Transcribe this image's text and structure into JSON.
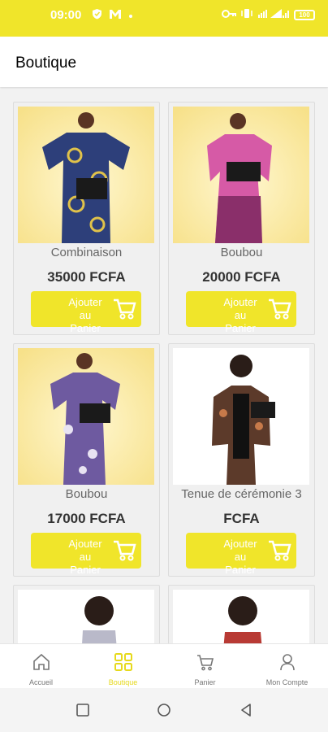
{
  "status_bar": {
    "time": "09:00",
    "battery": "100"
  },
  "app_bar": {
    "title": "Boutique"
  },
  "add_to_cart_label": "Ajouter au Panier",
  "products": [
    {
      "name": "Combinaison",
      "price": "35000 FCFA"
    },
    {
      "name": "Boubou",
      "price": "20000 FCFA"
    },
    {
      "name": "Boubou",
      "price": "17000 FCFA"
    },
    {
      "name": "Tenue de cérémonie 3",
      "price": "FCFA"
    }
  ],
  "bottom_nav": {
    "items": [
      {
        "label": "Accueil",
        "icon": "home-icon"
      },
      {
        "label": "Boutique",
        "icon": "grid-icon",
        "active": true
      },
      {
        "label": "Panier",
        "icon": "cart-icon"
      },
      {
        "label": "Mon Compte",
        "icon": "user-icon"
      }
    ]
  },
  "colors": {
    "accent": "#f0e52a",
    "active_label": "#e6d91c"
  }
}
